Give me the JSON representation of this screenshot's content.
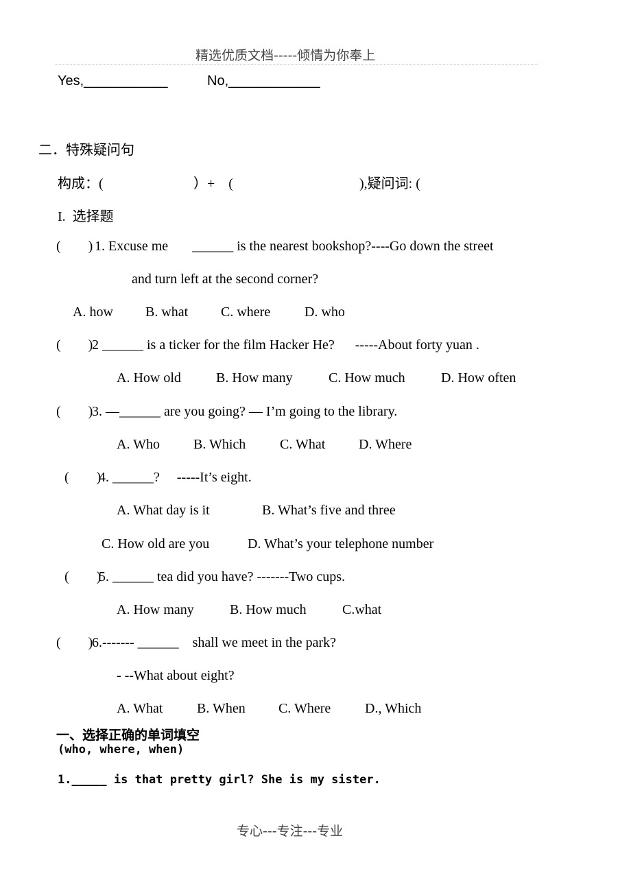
{
  "header": {
    "text": "精选优质文档-----倾情为你奉上"
  },
  "footer": {
    "text": "专心---专注---专业"
  },
  "yes_no": {
    "yes": "Yes,___________",
    "no": "No,____________"
  },
  "section2": {
    "title": "二．特殊疑问句",
    "structure_label": "构成：(",
    "structure_mid": "）+　(",
    "structure_end": "),疑问词: (",
    "part_title": "I.  选择题"
  },
  "questions": [
    {
      "paren": "(        )",
      "stem": "1. Excuse me       ______ is the nearest bookshop?----Go down the street",
      "stem2": "and turn left at the second corner?",
      "options": [
        "A. how",
        "B. what",
        "C. where",
        "D. who"
      ]
    },
    {
      "paren": "(        )",
      "stem": "2 ______ is a ticker for the film Hacker He?      -----About forty yuan .",
      "options": [
        "A. How old",
        "B. How many",
        "C. How much",
        "D. How often"
      ]
    },
    {
      "paren": "(        )",
      "stem": "3. —______ are you going? — I’m going to the library.",
      "options": [
        "A. Who",
        "B. Which",
        "C. What",
        "D. Where"
      ]
    },
    {
      "paren": "(        )",
      "stem": "4. ______?     -----It’s eight.",
      "options": [
        "A. What day is it",
        "B. What’s five and three",
        "C. How old are you",
        "D. What’s your telephone number"
      ]
    },
    {
      "paren": "(        )",
      "stem": "5. ______ tea did you have? -------Two cups.",
      "options": [
        "A. How many",
        "B. How much",
        "C.what"
      ]
    },
    {
      "paren": "(        )",
      "stem": "6.------- ______    shall we meet in the park?",
      "stem2": "- --What about eight?",
      "options": [
        "A. What",
        "B. When",
        "C. Where",
        "D., Which"
      ]
    }
  ],
  "section1": {
    "title": "一、选择正确的单词填空",
    "words": "(who, where, when)",
    "q1": "1._____ is that pretty girl? She is my sister."
  }
}
